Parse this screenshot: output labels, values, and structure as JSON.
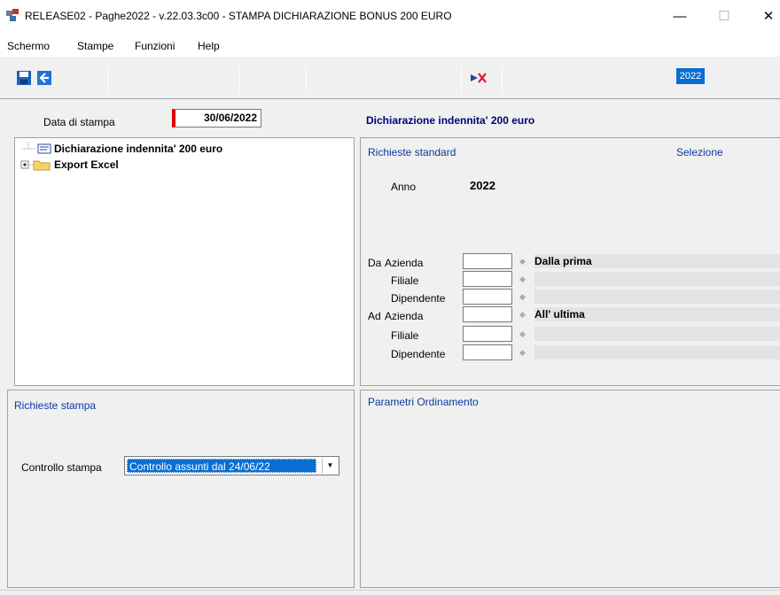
{
  "window": {
    "title": "RELEASE02 - Paghe2022 - v.22.03.3c00 - STAMPA DICHIARAZIONE BONUS 200 EURO",
    "minimize": "—",
    "maximize": "☐",
    "close": "✕"
  },
  "menu": [
    "Schermo",
    "Stampe",
    "Funzioni",
    "Help"
  ],
  "toolbar": {
    "year": "2022",
    "icons": [
      "save-icon",
      "back-arrow-icon",
      "cancel-print-icon"
    ]
  },
  "header": {
    "date_label": "Data di stampa",
    "date_value": "30/06/2022",
    "section_title": "Dichiarazione indennita' 200 euro"
  },
  "tree": {
    "items": [
      {
        "label": "Dichiarazione indennita' 200 euro",
        "icon": "document-icon"
      },
      {
        "label": "Export Excel",
        "icon": "folder-icon"
      }
    ]
  },
  "requests": {
    "title": "Richieste standard",
    "selection_label": "Selezione",
    "anno_label": "Anno",
    "anno_value": "2022",
    "rows": [
      {
        "prefix": "Da",
        "label": "Azienda",
        "desc": "Dalla prima"
      },
      {
        "prefix": "",
        "label": "Filiale",
        "desc": ""
      },
      {
        "prefix": "",
        "label": "Dipendente",
        "desc": ""
      },
      {
        "prefix": "Ad",
        "label": "Azienda",
        "desc": "All' ultima"
      },
      {
        "prefix": "",
        "label": "Filiale",
        "desc": ""
      },
      {
        "prefix": "",
        "label": "Dipendente",
        "desc": ""
      }
    ]
  },
  "print_requests": {
    "title": "Richieste stampa",
    "control_label": "Controllo stampa",
    "control_value": "Controllo assunti dal 24/06/22"
  },
  "ordering": {
    "title": "Parametri Ordinamento"
  }
}
